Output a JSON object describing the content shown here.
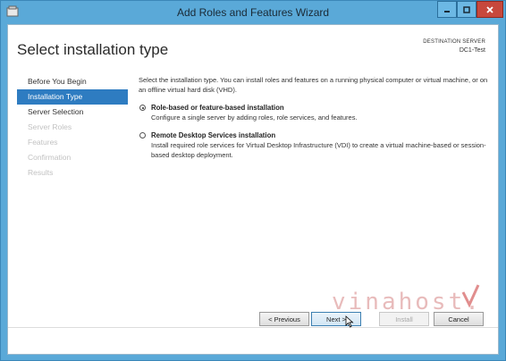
{
  "window": {
    "title": "Add Roles and Features Wizard",
    "buttons": {
      "minimize": "minimize-icon",
      "maximize": "maximize-icon",
      "close": "close-icon"
    }
  },
  "header": {
    "page_title": "Select installation type",
    "destination_label": "DESTINATION SERVER",
    "destination_value": "DC1-Test"
  },
  "nav": {
    "items": [
      {
        "label": "Before You Begin",
        "state": "normal"
      },
      {
        "label": "Installation Type",
        "state": "active"
      },
      {
        "label": "Server Selection",
        "state": "normal"
      },
      {
        "label": "Server Roles",
        "state": "disabled"
      },
      {
        "label": "Features",
        "state": "disabled"
      },
      {
        "label": "Confirmation",
        "state": "disabled"
      },
      {
        "label": "Results",
        "state": "disabled"
      }
    ]
  },
  "content": {
    "intro": "Select the installation type. You can install roles and features on a running physical computer or virtual machine, or on an offline virtual hard disk (VHD).",
    "options": [
      {
        "title": "Role-based or feature-based installation",
        "description": "Configure a single server by adding roles, role services, and features.",
        "selected": true
      },
      {
        "title": "Remote Desktop Services installation",
        "description": "Install required role services for Virtual Desktop Infrastructure (VDI) to create a virtual machine-based or session-based desktop deployment.",
        "selected": false
      }
    ]
  },
  "footer": {
    "previous": "< Previous",
    "next": "Next >",
    "install": "Install",
    "cancel": "Cancel"
  },
  "watermark": {
    "text": "vinahost."
  },
  "colors": {
    "titlebar": "#5aa9d8",
    "nav_active": "#2e7cc1",
    "close_button": "#c7483c"
  }
}
